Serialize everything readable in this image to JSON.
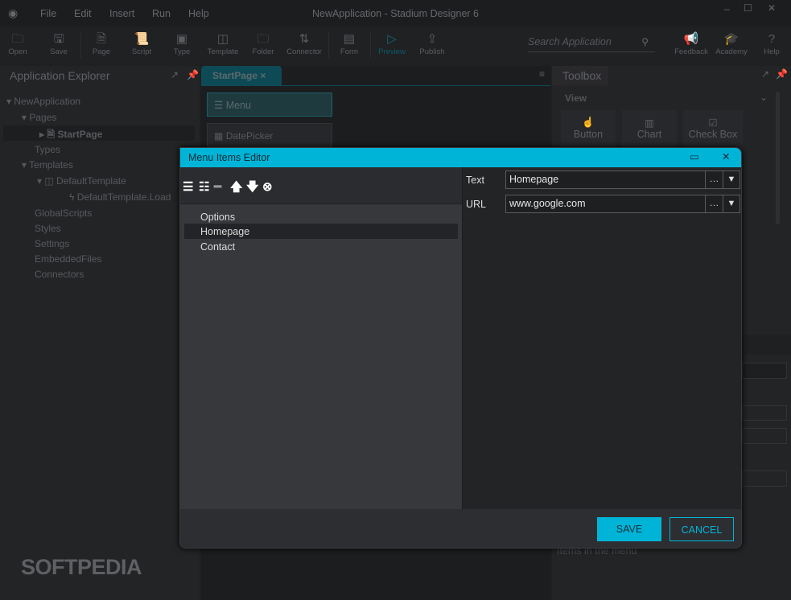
{
  "app": {
    "title": "NewApplication - Stadium Designer 6",
    "menu": [
      "File",
      "Edit",
      "Insert",
      "Run",
      "Help"
    ]
  },
  "toolbar": {
    "items": [
      {
        "label": "Open",
        "icon": "folder-open-icon",
        "glyph": "🗀"
      },
      {
        "label": "Save",
        "icon": "save-icon",
        "glyph": "🖫"
      },
      {
        "label": "Page",
        "icon": "page-icon",
        "glyph": "🗎"
      },
      {
        "label": "Script",
        "icon": "script-icon",
        "glyph": "📜"
      },
      {
        "label": "Type",
        "icon": "type-icon",
        "glyph": "▣"
      },
      {
        "label": "Template",
        "icon": "template-icon",
        "glyph": "◫"
      },
      {
        "label": "Folder",
        "icon": "folder-icon",
        "glyph": "🗀"
      },
      {
        "label": "Connector",
        "icon": "connector-icon",
        "glyph": "⇅"
      },
      {
        "label": "Form",
        "icon": "form-icon",
        "glyph": "▤"
      },
      {
        "label": "Preview",
        "icon": "play-icon",
        "glyph": "▷"
      },
      {
        "label": "Publish",
        "icon": "publish-icon",
        "glyph": "⇪"
      }
    ],
    "search_placeholder": "Search Application",
    "right": [
      {
        "label": "Feedback",
        "glyph": "📢"
      },
      {
        "label": "Academy",
        "glyph": "🎓"
      },
      {
        "label": "Help",
        "glyph": "?"
      }
    ]
  },
  "explorer": {
    "title": "Application Explorer",
    "tree": [
      "NewApplication",
      "Pages",
      "StartPage",
      "Types",
      "Templates",
      "DefaultTemplate",
      "DefaultTemplate.Load",
      "GlobalScripts",
      "Styles",
      "Settings",
      "EmbeddedFiles",
      "Connectors"
    ]
  },
  "editor": {
    "tab": "StartPage",
    "controls": [
      "Menu",
      "DatePicker"
    ]
  },
  "toolbox": {
    "title": "Toolbox",
    "section": "View",
    "items": [
      "Button",
      "Chart",
      "Check Box"
    ],
    "hint": "Items in the menu"
  },
  "dialog": {
    "title": "Menu Items Editor",
    "items": [
      "Options",
      "Homepage",
      "Contact"
    ],
    "selected": "Homepage",
    "fields": [
      {
        "label": "Text",
        "value": "Homepage"
      },
      {
        "label": "URL",
        "value": "www.google.com"
      }
    ],
    "save": "SAVE",
    "cancel": "CANCEL"
  },
  "watermark": "SOFTPEDIA",
  "colors": {
    "accent": "#00b4d8"
  }
}
